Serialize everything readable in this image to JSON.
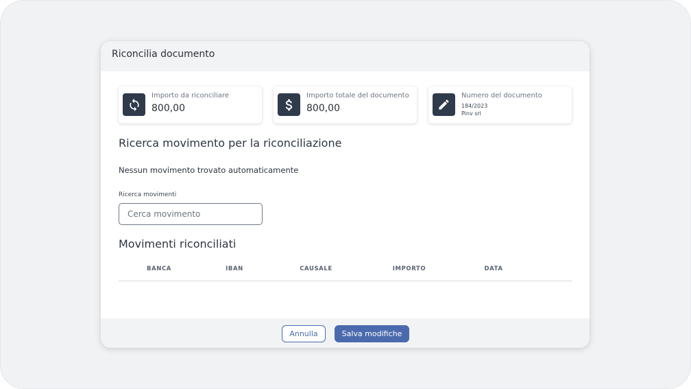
{
  "dialog": {
    "title": "Riconcilia documento"
  },
  "cards": [
    {
      "icon": "sync-icon",
      "label": "Importo da riconciliare",
      "value": "800,00"
    },
    {
      "icon": "dollar-icon",
      "label": "Importo totale del documento",
      "value": "800,00"
    },
    {
      "icon": "pencil-icon",
      "label": "Numero del documento",
      "line1": "184/2023",
      "line2": "Pinv srl"
    }
  ],
  "search_section": {
    "title": "Ricerca movimento per la riconciliazione",
    "info": "Nessun movimento trovato automaticamente",
    "field_label": "Ricerca movimenti",
    "placeholder": "Cerca movimento",
    "value": ""
  },
  "reconciled": {
    "title": "Movimenti riconciliati",
    "columns": [
      "BANCA",
      "IBAN",
      "CAUSALE",
      "IMPORTO",
      "DATA"
    ],
    "rows": []
  },
  "footer": {
    "cancel_label": "Annulla",
    "save_label": "Salva modifiche"
  },
  "colors": {
    "primary": "#4a6aad",
    "icon_bg": "#2f3a4b",
    "header_bg": "#f2f3f5"
  }
}
